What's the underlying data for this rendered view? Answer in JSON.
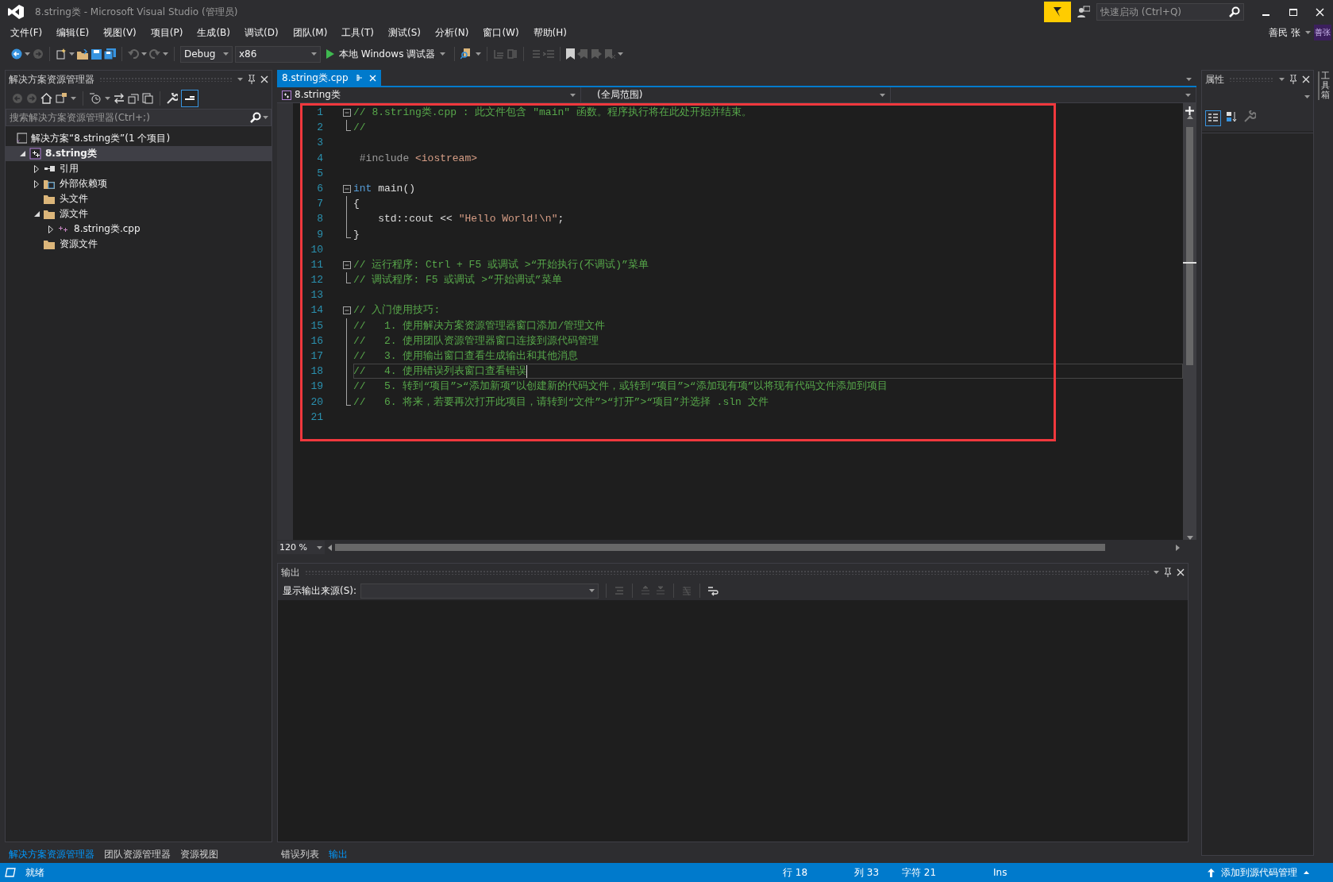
{
  "window": {
    "title": "8.string类 - Microsoft Visual Studio (管理员)",
    "quick_launch": {
      "placeholder": "快速启动 (Ctrl+Q)"
    }
  },
  "menu": [
    "文件(F)",
    "编辑(E)",
    "视图(V)",
    "项目(P)",
    "生成(B)",
    "调试(D)",
    "团队(M)",
    "工具(T)",
    "测试(S)",
    "分析(N)",
    "窗口(W)",
    "帮助(H)"
  ],
  "account": {
    "user": "善民 张",
    "avatar": "善张"
  },
  "toolbar": {
    "configuration": "Debug",
    "platform": "x86",
    "run_label": "本地 Windows 调试器"
  },
  "solution_explorer": {
    "title": "解决方案资源管理器",
    "search": {
      "placeholder": "搜索解决方案资源管理器(Ctrl+;)"
    },
    "tree": [
      {
        "label": "解决方案“8.string类”(1 个项目)",
        "kind": "solution",
        "selected": false,
        "bold": false,
        "children": [
          {
            "label": "8.string类",
            "kind": "project",
            "expanded": true,
            "selected": true,
            "bold": true,
            "children": [
              {
                "label": "引用",
                "kind": "references",
                "expanded": false,
                "selected": false,
                "bold": false
              },
              {
                "label": "外部依赖项",
                "kind": "external",
                "expanded": false,
                "selected": false,
                "bold": false
              },
              {
                "label": "头文件",
                "kind": "folder",
                "selected": false,
                "bold": false
              },
              {
                "label": "源文件",
                "kind": "folder",
                "expanded": true,
                "selected": false,
                "bold": false,
                "children": [
                  {
                    "label": "8.string类.cpp",
                    "kind": "cpp",
                    "expanded": false,
                    "selected": false,
                    "bold": false
                  }
                ]
              },
              {
                "label": "资源文件",
                "kind": "folder",
                "selected": false,
                "bold": false
              }
            ]
          }
        ]
      }
    ]
  },
  "editor": {
    "tab": {
      "label": "8.string类.cpp",
      "selected": true
    },
    "project_scope": "8.string类",
    "member_scope": "(全局范围)",
    "zoom": "120 %",
    "lines": [
      {
        "number": "1",
        "kind": "foldstart",
        "current": false,
        "tokens": [
          {
            "kind": "comment",
            "text": "// 8.string类.cpp : 此文件包含 \"main\" 函数。程序执行将在此处开始并结束。"
          }
        ]
      },
      {
        "number": "2",
        "kind": "foldend",
        "current": false,
        "tokens": [
          {
            "kind": "comment",
            "text": "//"
          }
        ]
      },
      {
        "number": "3",
        "kind": "plain",
        "current": false
      },
      {
        "number": "4",
        "kind": "plain",
        "current": false,
        "tokens": [
          {
            "kind": "preprocessor",
            "text": "#include"
          },
          {
            "kind": "string",
            "text": "<iostream>"
          }
        ]
      },
      {
        "number": "5",
        "kind": "plain",
        "current": false
      },
      {
        "number": "6",
        "kind": "foldstart",
        "current": false,
        "tokens": [
          {
            "kind": "keyword",
            "text": "int"
          },
          {
            "kind": "plain",
            "text": " main()"
          }
        ]
      },
      {
        "number": "7",
        "kind": "foldbody",
        "current": false,
        "tokens": [
          {
            "kind": "plain",
            "text": "{"
          }
        ]
      },
      {
        "number": "8",
        "kind": "foldbody",
        "current": false,
        "tokens": [
          {
            "kind": "plain",
            "text": "    std::cout << "
          },
          {
            "kind": "string",
            "text": "\"Hello World!\\n\""
          },
          {
            "kind": "plain",
            "text": ";"
          }
        ]
      },
      {
        "number": "9",
        "kind": "foldend",
        "current": false,
        "tokens": [
          {
            "kind": "plain",
            "text": "}"
          }
        ]
      },
      {
        "number": "10",
        "kind": "plain",
        "current": false
      },
      {
        "number": "11",
        "kind": "foldstart",
        "current": false,
        "tokens": [
          {
            "kind": "comment",
            "text": "// 运行程序: Ctrl + F5 或调试 >“开始执行(不调试)”菜单"
          }
        ]
      },
      {
        "number": "12",
        "kind": "foldend",
        "current": false,
        "tokens": [
          {
            "kind": "comment",
            "text": "// 调试程序: F5 或调试 >“开始调试”菜单"
          }
        ]
      },
      {
        "number": "13",
        "kind": "plain",
        "current": false
      },
      {
        "number": "14",
        "kind": "foldstart",
        "current": false,
        "tokens": [
          {
            "kind": "comment",
            "text": "// 入门使用技巧:"
          }
        ]
      },
      {
        "number": "15",
        "kind": "foldbody",
        "current": false,
        "tokens": [
          {
            "kind": "comment",
            "text": "//   1. 使用解决方案资源管理器窗口添加/管理文件"
          }
        ]
      },
      {
        "number": "16",
        "kind": "foldbody",
        "current": false,
        "tokens": [
          {
            "kind": "comment",
            "text": "//   2. 使用团队资源管理器窗口连接到源代码管理"
          }
        ]
      },
      {
        "number": "17",
        "kind": "foldbody",
        "current": false,
        "tokens": [
          {
            "kind": "comment",
            "text": "//   3. 使用输出窗口查看生成输出和其他消息"
          }
        ]
      },
      {
        "number": "18",
        "kind": "foldbody",
        "current": true,
        "tokens": [
          {
            "kind": "comment",
            "text": "//   4. 使用错误列表窗口查看错误"
          }
        ]
      },
      {
        "number": "19",
        "kind": "foldbody",
        "current": false,
        "tokens": [
          {
            "kind": "comment",
            "text": "//   5. 转到“项目”>“添加新项”以创建新的代码文件，或转到“项目”>“添加现有项”以将现有代码文件添加到项目"
          }
        ]
      },
      {
        "number": "20",
        "kind": "foldend",
        "current": false,
        "tokens": [
          {
            "kind": "comment",
            "text": "//   6. 将来，若要再次打开此项目，请转到“文件”>“打开”>“项目”并选择 .sln 文件"
          }
        ]
      },
      {
        "number": "21",
        "kind": "plain",
        "current": false
      }
    ]
  },
  "output": {
    "title": "输出",
    "source_label": "显示输出来源(S):"
  },
  "left_tabs": [
    {
      "label": "解决方案资源管理器",
      "selected": true
    },
    {
      "label": "团队资源管理器",
      "selected": false
    },
    {
      "label": "资源视图",
      "selected": false
    }
  ],
  "bottom_tabs": [
    {
      "label": "错误列表",
      "selected": false
    },
    {
      "label": "输出",
      "selected": true
    }
  ],
  "properties": {
    "title": "属性"
  },
  "toolbox_tab": "工具箱",
  "status_bar": {
    "state": "就绪",
    "line": "行 18",
    "column": "列 33",
    "char": "字符 21",
    "mode": "Ins",
    "source_control": "添加到源代码管理"
  }
}
